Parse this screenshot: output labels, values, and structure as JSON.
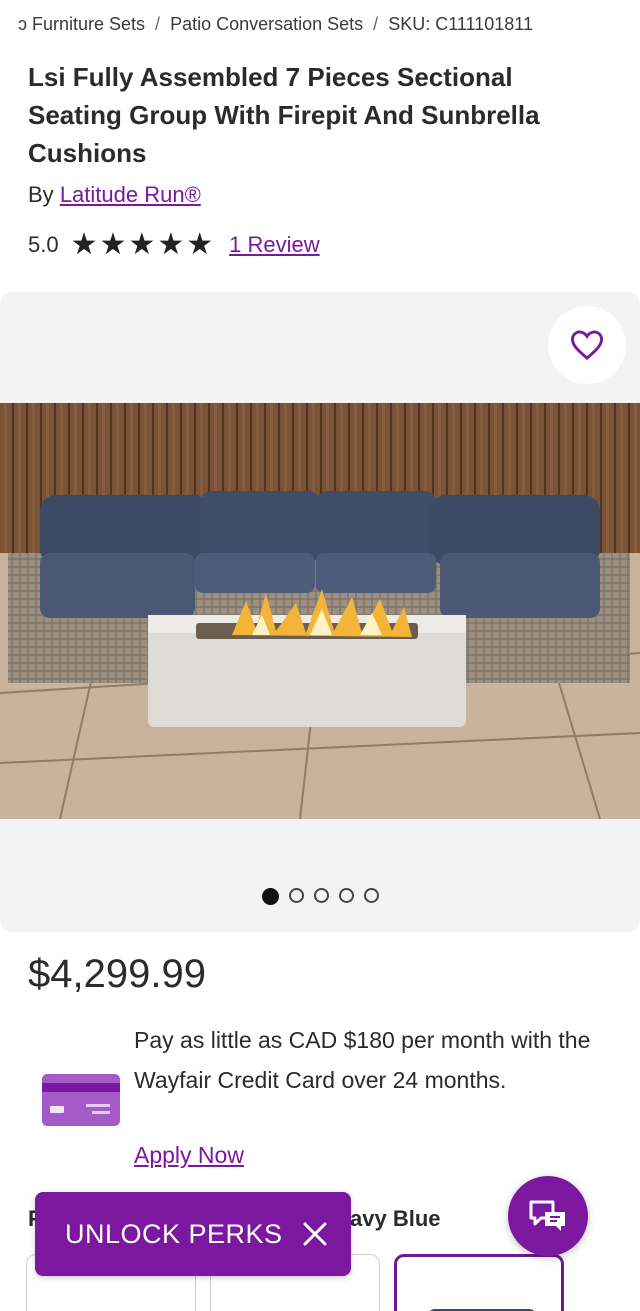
{
  "breadcrumb": {
    "items": [
      "ɔ Furniture Sets",
      "Patio Conversation Sets",
      "SKU: C111101811"
    ],
    "separator": "/"
  },
  "product": {
    "title": "Lsi Fully Assembled 7 Pieces Sectional Seating Group With Firepit And Sunbrella Cushions",
    "by_prefix": "By",
    "brand": "Latitude Run®",
    "rating": "5.0",
    "star_count": 5,
    "reviews_link": "1 Review",
    "price": "$4,299.99"
  },
  "gallery": {
    "favorite_icon": "heart-outline-icon",
    "image_count": 5,
    "active_index": 0
  },
  "financing": {
    "text": "Pay as little as CAD $180 per month with the Wayfair Credit Card over 24 months.",
    "link": "Apply Now",
    "icon": "credit-card-icon"
  },
  "variant": {
    "label_fragment": "F",
    "value": "avy Blue",
    "swatch_colors": [
      "#a89a86",
      "#b8ab96",
      "#3a4a66"
    ],
    "selected_index": 2
  },
  "perks_banner": {
    "label": "UNLOCK PERKS",
    "close_icon": "close-icon"
  },
  "chat": {
    "icon": "chat-bubbles-icon"
  },
  "colors": {
    "accent": "#7b189f",
    "text": "#2b2b2b",
    "gallery_bg": "#f3f3f3"
  }
}
